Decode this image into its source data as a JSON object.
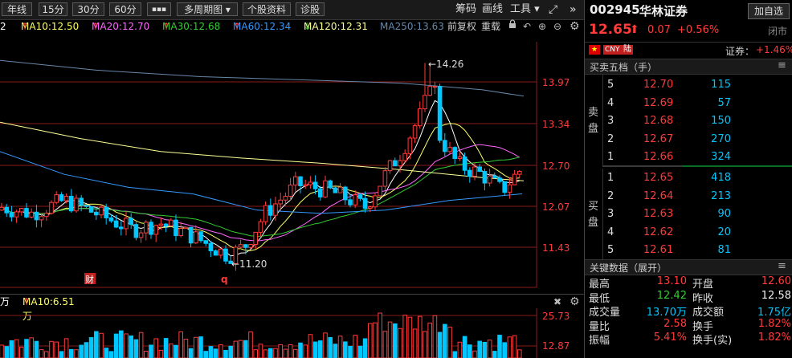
{
  "toolbar": {
    "periods": [
      "年线",
      "15分",
      "30分",
      "60分"
    ],
    "more_label": "▪▪▪",
    "multi_period": "多周期图",
    "stock_info": "个股资料",
    "diagnose": "诊股",
    "chips": "筹码",
    "draw": "画线",
    "tools": "工具"
  },
  "ma": {
    "ma5": "2",
    "ma10": "MA10:12.50",
    "ma20": "MA20:12.70",
    "ma30": "MA30:12.68",
    "ma60": "MA60:12.34",
    "ma120": "MA120:12.31",
    "ma250": "MA250:13.63",
    "adjust": "前复权",
    "overlay": "重载"
  },
  "chart": {
    "price_labels": [
      "13.97",
      "13.34",
      "12.70",
      "12.07",
      "11.43"
    ],
    "high_annot": "←14.26",
    "low_annot": "←11.20",
    "marker_cai": "财",
    "marker_q": "q"
  },
  "volume": {
    "unit_prefix": "万",
    "ma10": "MA10:6.51万",
    "labels": [
      "25.73",
      "12.87"
    ]
  },
  "quote": {
    "code": "002945",
    "name": "华林证券",
    "add_label": "加自选",
    "price": "12.65",
    "change": "0.07",
    "change_pct": "+0.56%",
    "status": "闭市",
    "tag_cny": "CNY",
    "tag_lu": "陆",
    "sector": "证券：",
    "sector_pct": "+1.46%"
  },
  "orderbook": {
    "title": "买卖五档（手）",
    "sell_label": [
      "卖",
      "盘"
    ],
    "buy_label": [
      "买",
      "盘"
    ],
    "sell": [
      {
        "level": "5",
        "price": "12.70",
        "vol": "115"
      },
      {
        "level": "4",
        "price": "12.69",
        "vol": "57"
      },
      {
        "level": "3",
        "price": "12.68",
        "vol": "150"
      },
      {
        "level": "2",
        "price": "12.67",
        "vol": "270"
      },
      {
        "level": "1",
        "price": "12.66",
        "vol": "324"
      }
    ],
    "buy": [
      {
        "level": "1",
        "price": "12.65",
        "vol": "418"
      },
      {
        "level": "2",
        "price": "12.64",
        "vol": "213"
      },
      {
        "level": "3",
        "price": "12.63",
        "vol": "90"
      },
      {
        "level": "4",
        "price": "12.62",
        "vol": "20"
      },
      {
        "level": "5",
        "price": "12.61",
        "vol": "81"
      }
    ]
  },
  "keydata": {
    "title": "关键数据（展开）",
    "rows": [
      {
        "l1": "最高",
        "v1": "13.10",
        "l2": "开盘",
        "v2": "12.60"
      },
      {
        "l1": "最低",
        "v1": "12.42",
        "l2": "昨收",
        "v2": "12.58"
      },
      {
        "l1": "成交量",
        "v1": "13.70万",
        "l2": "成交额",
        "v2": "1.75亿"
      },
      {
        "l1": "量比",
        "v1": "2.58",
        "l2": "换手",
        "v2": "1.82%"
      },
      {
        "l1": "振幅",
        "v1": "5.41%",
        "l2": "换手(实)",
        "v2": "1.82%"
      }
    ]
  },
  "colors": {
    "up": "#ff3b3b",
    "down": "#00c8ff",
    "ma10": "#ffff66",
    "ma20": "#ff66ff",
    "ma30": "#33cc33",
    "ma60": "#3399ff",
    "ma120": "#ffff99",
    "ma250": "#6688aa",
    "grid": "#8b1a1a"
  }
}
